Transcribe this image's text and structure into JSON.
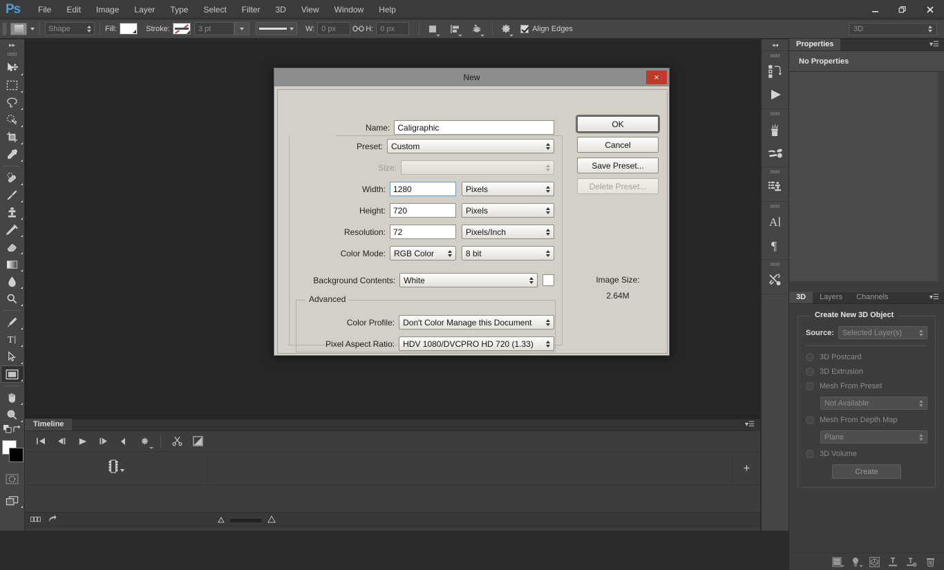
{
  "app": {
    "name": "Ps",
    "logo": "Ps"
  },
  "titlebar": {
    "menus": [
      "File",
      "Edit",
      "Image",
      "Layer",
      "Type",
      "Select",
      "Filter",
      "3D",
      "View",
      "Window",
      "Help"
    ],
    "controls": {
      "minimize": "minimize-icon",
      "restore": "restore-icon",
      "close": "close-icon"
    }
  },
  "options_bar": {
    "tool_mode": "Shape",
    "fill_label": "Fill:",
    "stroke_label": "Stroke:",
    "stroke_width": "3 pt",
    "width_label": "W:",
    "width_value": "0 px",
    "height_label": "H:",
    "height_value": "0 px",
    "align_edges_label": "Align Edges",
    "align_edges_checked": true,
    "workspace": "3D"
  },
  "toolbar": {
    "tools": [
      {
        "name": "move-tool",
        "has_submenu": true,
        "selected": false
      },
      {
        "name": "rectangular-marquee-tool",
        "has_submenu": true,
        "selected": false
      },
      {
        "name": "lasso-tool",
        "has_submenu": true,
        "selected": false
      },
      {
        "name": "quick-selection-tool",
        "has_submenu": true,
        "selected": false
      },
      {
        "name": "crop-tool",
        "has_submenu": true,
        "selected": false
      },
      {
        "name": "eyedropper-tool",
        "has_submenu": true,
        "selected": false
      },
      {
        "name": "spot-healing-brush-tool",
        "has_submenu": true,
        "selected": false
      },
      {
        "name": "brush-tool",
        "has_submenu": true,
        "selected": false
      },
      {
        "name": "clone-stamp-tool",
        "has_submenu": true,
        "selected": false
      },
      {
        "name": "history-brush-tool",
        "has_submenu": true,
        "selected": false
      },
      {
        "name": "eraser-tool",
        "has_submenu": true,
        "selected": false
      },
      {
        "name": "gradient-tool",
        "has_submenu": true,
        "selected": false
      },
      {
        "name": "blur-tool",
        "has_submenu": true,
        "selected": false
      },
      {
        "name": "dodge-tool",
        "has_submenu": true,
        "selected": false
      },
      {
        "name": "pen-tool",
        "has_submenu": true,
        "selected": false
      },
      {
        "name": "horizontal-type-tool",
        "has_submenu": true,
        "selected": false
      },
      {
        "name": "path-selection-tool",
        "has_submenu": true,
        "selected": false
      },
      {
        "name": "rectangle-tool",
        "has_submenu": true,
        "selected": true
      },
      {
        "name": "hand-tool",
        "has_submenu": true,
        "selected": false
      },
      {
        "name": "zoom-tool",
        "has_submenu": true,
        "selected": false
      }
    ],
    "foreground_color": "#ffffff",
    "background_color": "#000000",
    "quickmask": "quick-mask-icon",
    "screenmode": "screen-mode-icon"
  },
  "dialog": {
    "title": "New",
    "close_label": "×",
    "fields": {
      "name_label": "Name:",
      "name_value": "Caligraphic",
      "preset_label": "Preset:",
      "preset_value": "Custom",
      "size_label": "Size:",
      "size_value": "",
      "width_label": "Width:",
      "width_value": "1280",
      "width_unit": "Pixels",
      "height_label": "Height:",
      "height_value": "720",
      "height_unit": "Pixels",
      "resolution_label": "Resolution:",
      "resolution_value": "72",
      "resolution_unit": "Pixels/Inch",
      "color_mode_label": "Color Mode:",
      "color_mode_value": "RGB Color",
      "color_depth_value": "8 bit",
      "background_contents_label": "Background Contents:",
      "background_contents_value": "White",
      "background_swatch_color": "#ffffff"
    },
    "advanced": {
      "group_title": "Advanced",
      "color_profile_label": "Color Profile:",
      "color_profile_value": "Don't Color Manage this Document",
      "pixel_aspect_label": "Pixel Aspect Ratio:",
      "pixel_aspect_value": "HDV 1080/DVCPRO HD 720 (1.33)"
    },
    "image_size": {
      "label": "Image Size:",
      "value": "2.64M"
    },
    "buttons": [
      {
        "label": "OK",
        "state": "default"
      },
      {
        "label": "Cancel",
        "state": "normal"
      },
      {
        "label": "Save Preset...",
        "state": "normal"
      },
      {
        "label": "Delete Preset...",
        "state": "disabled"
      }
    ]
  },
  "timeline": {
    "tab": "Timeline",
    "controls": [
      "go-to-first-frame-icon",
      "previous-frame-icon",
      "play-icon",
      "next-frame-icon",
      "mute-audio-icon",
      "settings-gear-icon",
      "split-at-playhead-icon",
      "transition-icon"
    ],
    "filmstrip": "filmstrip-icon",
    "add_media": "+"
  },
  "right_dock": {
    "collapse": "expand-panels-icon",
    "groups": [
      [
        "history-icon",
        "actions-play-icon"
      ],
      [
        "brush-presets-icon",
        "tool-presets-icon"
      ],
      [
        "clone-source-icon"
      ],
      [
        "character-icon",
        "paragraph-icon"
      ],
      [
        "adjustments-tools-icon"
      ]
    ]
  },
  "properties_panel": {
    "tabs": [
      {
        "label": "Properties",
        "active": true
      }
    ],
    "empty_message": "No Properties"
  },
  "panel_3d": {
    "tabs": [
      {
        "label": "3D",
        "active": true
      },
      {
        "label": "Layers",
        "active": false
      },
      {
        "label": "Channels",
        "active": false
      }
    ],
    "group_title": "Create New 3D Object",
    "source_label": "Source:",
    "source_value": "Selected Layer(s)",
    "options": [
      {
        "label": "3D Postcard",
        "selected": false,
        "disabled": true
      },
      {
        "label": "3D Extrusion",
        "selected": false,
        "disabled": true
      },
      {
        "label": "Mesh From Preset",
        "selected": false,
        "disabled": true
      },
      {
        "label": "Mesh From Depth Map",
        "selected": false,
        "disabled": true
      },
      {
        "label": "3D Volume",
        "selected": false,
        "disabled": true
      }
    ],
    "preset_dropdown": "Not Available",
    "depth_dropdown": "Plane",
    "create_button": "Create",
    "footer_icons": [
      "render-icon",
      "light-icon",
      "material-icon",
      "add-mesh-icon",
      "remove-mesh-icon",
      "delete-icon"
    ]
  },
  "colors": {
    "app_bg": "#2b2b2b",
    "panel_bg": "#3d3d3d",
    "toolbar_bg": "#454545",
    "canvas_bg": "#262626",
    "dialog_bg": "#d4d0c8",
    "accent_blue": "#4a9fd8",
    "close_red": "#c0392b"
  }
}
